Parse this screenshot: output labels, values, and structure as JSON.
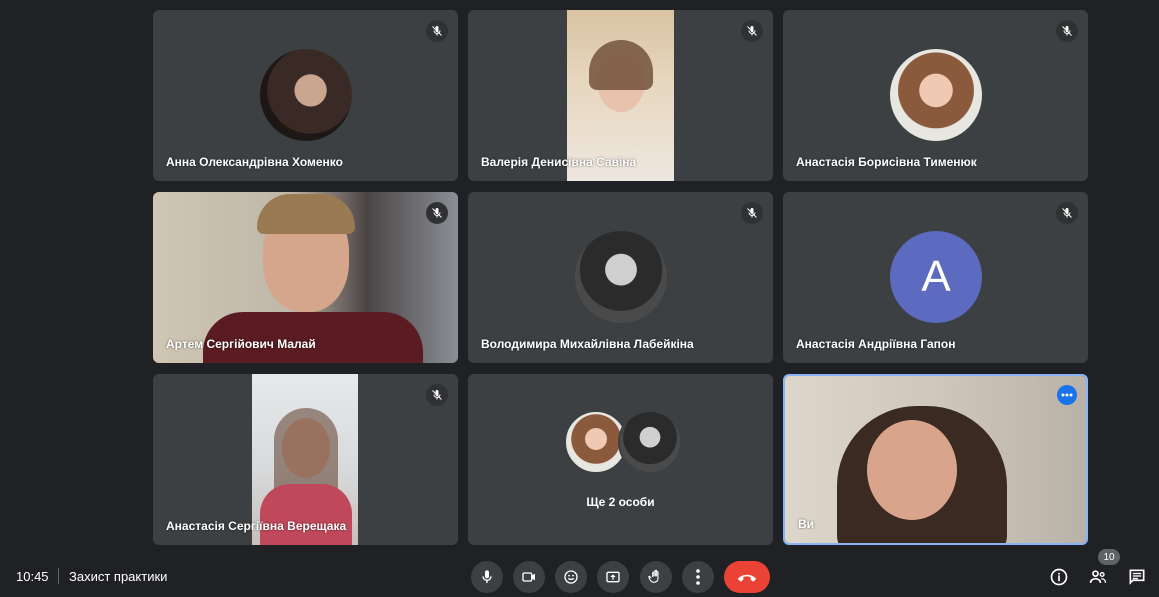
{
  "participants": [
    {
      "name": "Анна Олександрівна Хоменко",
      "muted": true
    },
    {
      "name": "Валерія Денисівна Савіна",
      "muted": true
    },
    {
      "name": "Анастасія Борисівна Тименюк",
      "muted": true
    },
    {
      "name": "Артем Сергійович Малай",
      "muted": true
    },
    {
      "name": "Володимира Михайлівна Лабейкіна",
      "muted": true
    },
    {
      "name": "Анастасія Андріївна Гапон",
      "muted": true,
      "avatar_letter": "A",
      "avatar_color": "#5c6bc0"
    },
    {
      "name": "Анастасія Сергіївна Верещака",
      "muted": true
    },
    {
      "more_label": "Ще 2 особи"
    },
    {
      "name": "Ви",
      "self": true
    }
  ],
  "bottom_bar": {
    "time": "10:45",
    "meeting_title": "Захист практики",
    "participant_count": "10"
  },
  "icons": {
    "mic": "microphone-icon",
    "camera": "camera-icon",
    "reactions": "emoji-icon",
    "present": "present-screen-icon",
    "raise_hand": "raise-hand-icon",
    "more": "more-options-icon",
    "leave": "hang-up-icon",
    "info": "info-icon",
    "people": "people-icon",
    "chat": "chat-icon"
  },
  "colors": {
    "background": "#202124",
    "tile": "#3c4043",
    "hangup": "#ea4335",
    "self_border": "#8ab4f8"
  }
}
